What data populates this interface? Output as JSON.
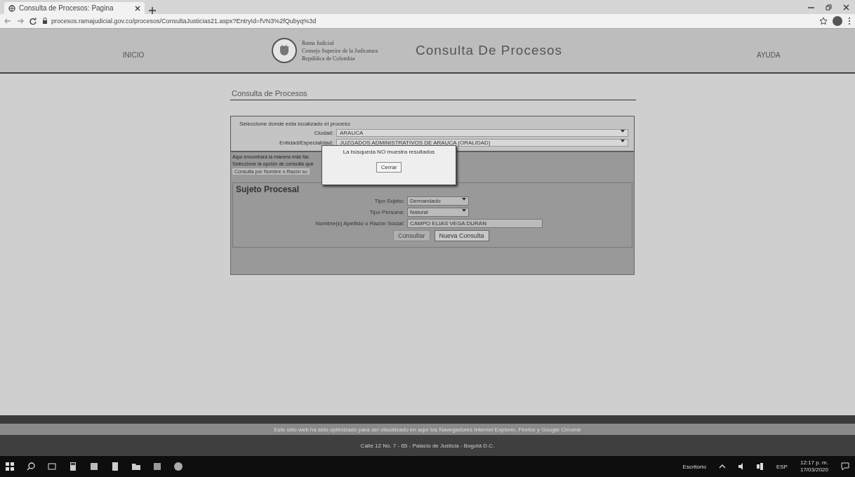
{
  "browser": {
    "tab_title": "Consulta de Procesos: Pagina",
    "url": "procesos.ramajudicial.gov.co/procesos/ConsultaJusticias21.aspx?EntryId=fVN3%2fQubyq%3d"
  },
  "header": {
    "nav_left": "INICIO",
    "logo_lines": [
      "Rama Judicial",
      "Consejo Superior de la Judicatura",
      "República de Colombia"
    ],
    "site_title": "Consulta De Procesos",
    "nav_right": "AYUDA"
  },
  "page_title": "Consulta de Procesos",
  "location": {
    "instruction": "Seleccione donde esta localizado el proceso",
    "fields": [
      {
        "label": "Ciudad:",
        "value": "ARAUCA"
      },
      {
        "label": "Entidad/Especialidad:",
        "value": "JUZGADOS ADMINISTRATIVOS DE ARAUCA (ORALIDAD)"
      }
    ]
  },
  "query": {
    "intro": "Aquí encontrará la manera más fác",
    "option_label": "Seleccione la opción de consulta que",
    "option_value": "Consulta por Nombre o Razón so"
  },
  "subject": {
    "title": "Sujeto Procesal",
    "fields": [
      {
        "kind": "select",
        "label": "Tipo Sujeto:",
        "value": "Demandado"
      },
      {
        "kind": "select",
        "label": "Tipo Persona:",
        "value": "Natural"
      },
      {
        "kind": "text",
        "label": "Nombre(s) Apellido o Razón Social:",
        "value": "CAMPO ELIAS VEGA DURAN"
      }
    ],
    "buttons": [
      {
        "label": "Consultar",
        "disabled": true
      },
      {
        "label": "Nueva Consulta",
        "disabled": false
      }
    ]
  },
  "dialog": {
    "message": "La búsqueda NO muestra resultados",
    "button": "Cerrar"
  },
  "footer": {
    "notice": "Este sitio web ha sido optimizado para ser visualizado en aquí los Navegadores Internet Explorer, Firefox y Google Chrome",
    "address": "Calle 12 No. 7 - 65 - Palacio de Justicia - Bogotá D.C."
  },
  "taskbar": {
    "desktop_label": "Escritorio",
    "language": "ESP",
    "time": "12:17 p. m.",
    "date": "17/03/2020"
  }
}
